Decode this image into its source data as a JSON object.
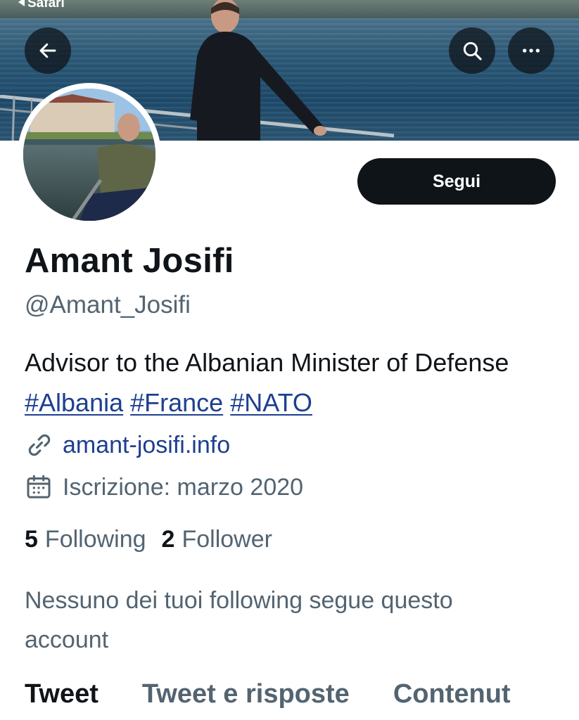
{
  "status_bar": {
    "back_app": "Safari"
  },
  "header": {
    "back_icon": "arrow-left-icon",
    "search_icon": "search-icon",
    "more_icon": "more-horizontal-icon"
  },
  "profile": {
    "follow_label": "Segui",
    "display_name": "Amant Josifi",
    "handle": "@Amant_Josifi",
    "bio_text": "Advisor to the Albanian Minister of Defense",
    "hashtags": [
      "#Albania",
      "#France",
      "#NATO"
    ],
    "website": "amant-josifi.info",
    "joined": "Iscrizione: marzo 2020",
    "following_count": "5",
    "following_label": "Following",
    "follower_count": "2",
    "follower_label": "Follower",
    "mutual_note": "Nessuno dei tuoi following segue questo account"
  },
  "tabs": [
    {
      "label": "Tweet",
      "active": true
    },
    {
      "label": "Tweet e risposte",
      "active": false
    },
    {
      "label": "Contenut",
      "active": false
    }
  ],
  "colors": {
    "primary_text": "#0f1419",
    "secondary_text": "#536471",
    "link": "#1d3f8f",
    "button_bg": "#0f1419"
  }
}
